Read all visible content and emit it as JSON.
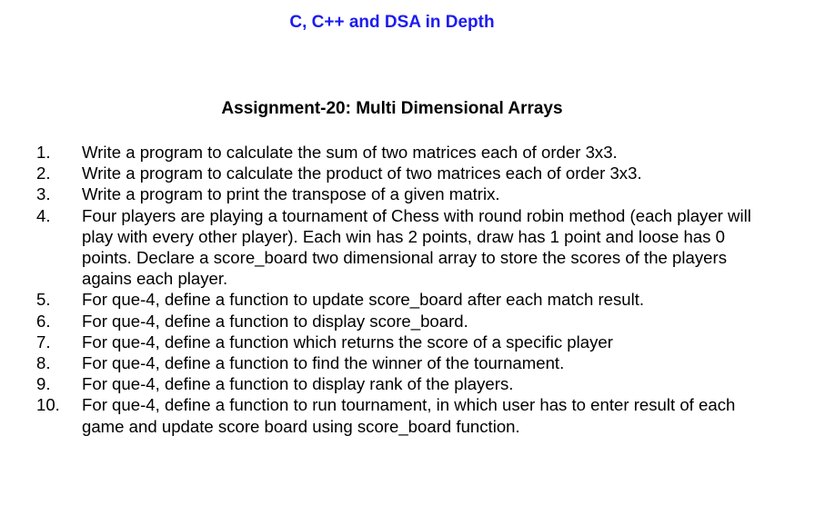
{
  "header": {
    "course_title": "C, C++ and DSA in Depth"
  },
  "assignment": {
    "title": "Assignment-20: Multi Dimensional Arrays"
  },
  "questions": [
    {
      "number": "1.",
      "text": "Write a program to calculate the sum of two matrices each of order 3x3."
    },
    {
      "number": "2.",
      "text": "Write a program to calculate the product of two matrices each of order 3x3."
    },
    {
      "number": "3.",
      "text": "Write a program to print the transpose of a given matrix."
    },
    {
      "number": "4.",
      "text": "Four players are playing a tournament of Chess with round robin method (each player will play with every other player). Each win has 2 points, draw has 1 point and loose has 0 points.  Declare a score_board two dimensional array to store the scores of the players agains each player."
    },
    {
      "number": "5.",
      "text": "For que-4, define a function to update score_board after each match result."
    },
    {
      "number": "6.",
      "text": "For que-4, define a function to display score_board."
    },
    {
      "number": "7.",
      "text": "For que-4, define a function which returns the score of a specific player"
    },
    {
      "number": "8.",
      "text": "For que-4, define a function to find the winner of the tournament."
    },
    {
      "number": "9.",
      "text": "For que-4, define a function to display rank of the players."
    },
    {
      "number": "10.",
      "text": "For que-4, define a function to run tournament, in which user has to enter result of each game and update score board using score_board function."
    }
  ]
}
